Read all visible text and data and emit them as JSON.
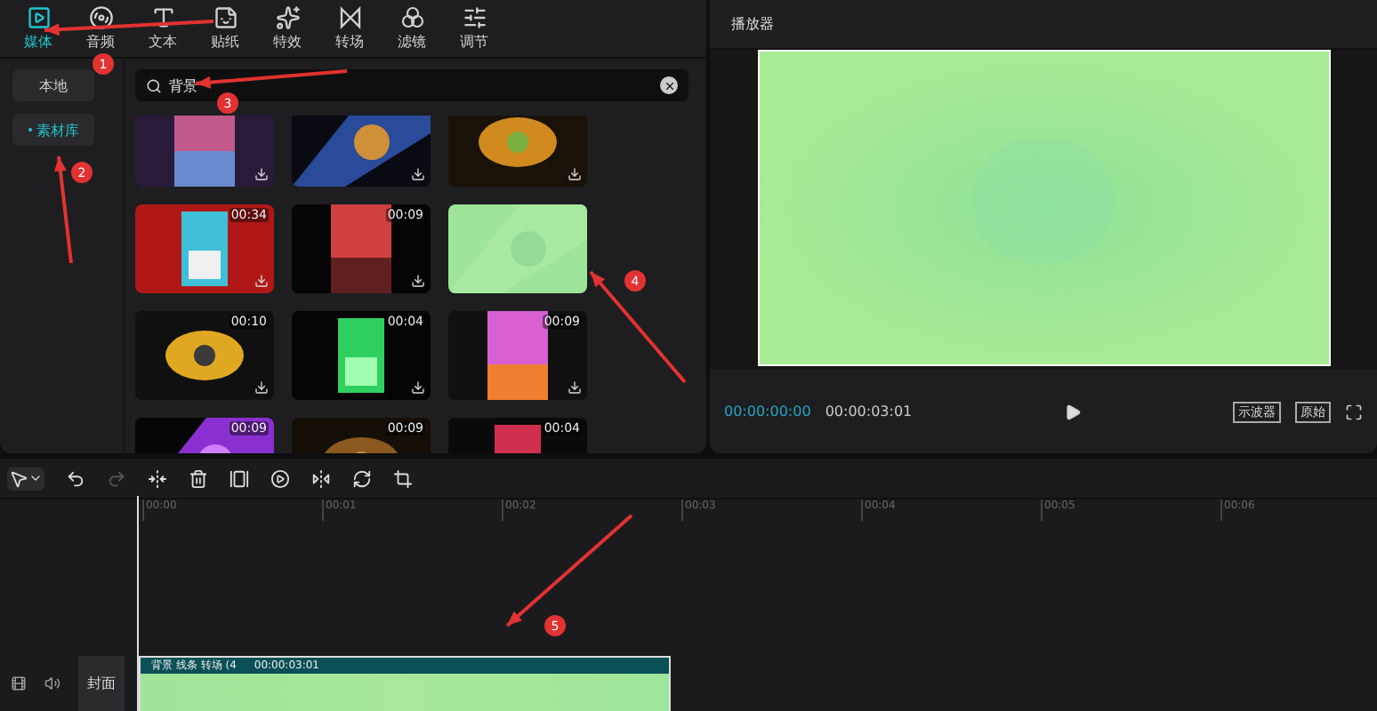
{
  "tabs": [
    {
      "label": "媒体",
      "selected": true
    },
    {
      "label": "音频",
      "selected": false
    },
    {
      "label": "文本",
      "selected": false
    },
    {
      "label": "贴纸",
      "selected": false
    },
    {
      "label": "特效",
      "selected": false
    },
    {
      "label": "转场",
      "selected": false
    },
    {
      "label": "滤镜",
      "selected": false
    },
    {
      "label": "调节",
      "selected": false
    }
  ],
  "sidebar": {
    "items": [
      {
        "label": "本地",
        "selected": false
      },
      {
        "label": "素材库",
        "selected": true
      }
    ]
  },
  "search": {
    "value": "背景"
  },
  "thumbnails": [
    {
      "downloadable": true
    },
    {
      "downloadable": true
    },
    {
      "downloadable": true
    },
    {
      "duration": "00:34",
      "downloadable": true
    },
    {
      "duration": "00:09",
      "downloadable": true
    },
    {
      "downloadable": false
    },
    {
      "duration": "00:10",
      "downloadable": true
    },
    {
      "duration": "00:04",
      "downloadable": true
    },
    {
      "duration": "00:09",
      "downloadable": true
    },
    {
      "duration": "00:09",
      "downloadable": false
    },
    {
      "duration": "00:09",
      "downloadable": false
    },
    {
      "duration": "00:04",
      "downloadable": false
    }
  ],
  "player": {
    "title": "播放器",
    "current_time": "00:00:00:00",
    "total_time": "00:00:03:01",
    "buttons": [
      "示波器",
      "原始"
    ]
  },
  "timeline": {
    "ticks": [
      "00:00",
      "00:01",
      "00:02",
      "00:03",
      "00:04",
      "00:05",
      "00:06"
    ],
    "clip": {
      "name": "背景 线条 转场 (4",
      "duration": "00:00:03:01"
    },
    "cover_button": "封面"
  },
  "annotations": [
    "1",
    "2",
    "3",
    "4",
    "5"
  ]
}
